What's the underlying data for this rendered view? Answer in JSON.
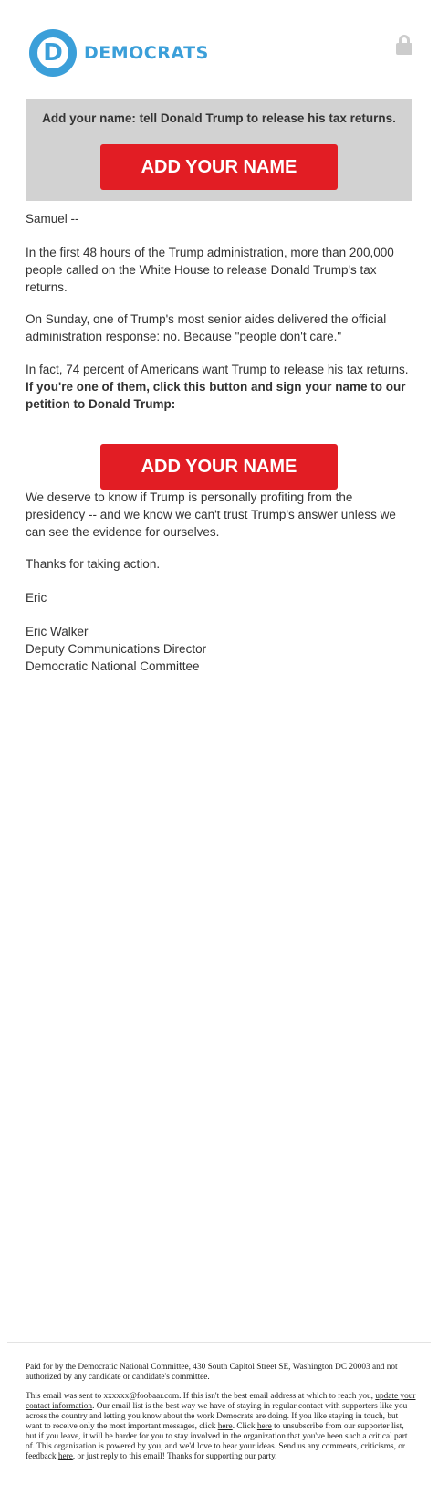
{
  "header": {
    "logo_letter": "D",
    "logo_text": "DEMOCRATS",
    "brand_color": "#3b9fd9",
    "lock_icon": "lock-icon"
  },
  "banner": {
    "text": "Add your name: tell Donald Trump to release his tax returns.",
    "button_label": "ADD YOUR NAME",
    "background": "#d2d2d2",
    "button_color": "#e21d24"
  },
  "email": {
    "greeting": "Samuel --",
    "p1": "In the first 48 hours of the Trump administration, more than 200,000 people called on the White House to release Donald Trump's tax returns.",
    "p2": "On Sunday, one of Trump's most senior aides delivered the official administration response: no. Because \"people don't care.\"",
    "p3_plain": "In fact, 74 percent of Americans want Trump to release his tax returns.",
    "p3_bold": "If you're one of them, click this button and sign your name to our petition to Donald Trump:",
    "button_label": "ADD YOUR NAME",
    "p4": "We deserve to know if Trump is personally profiting from the presidency -- and we know we can't trust Trump's answer unless we can see the evidence for ourselves.",
    "thanks": "Thanks for taking action.",
    "sign_name": "Eric",
    "signature": {
      "name": "Eric Walker",
      "title": "Deputy Communications Director",
      "org": "Democratic National Committee"
    }
  },
  "footer": {
    "paid_for": "Paid for by the Democratic National Committee, 430 South Capitol Street SE, Washington DC 20003 and not authorized by any candidate or candidate's committee.",
    "t1": "This email was sent to xxxxxx@foobaar.com. If this isn't the best email address at which to reach you, ",
    "update_link": "update your contact information",
    "t2": ". Our email list is the best way we have of staying in regular contact with supporters like you across the country and letting you know about the work Democrats are doing. If you like staying in touch, but want to receive only the most important messages, click ",
    "here1": "here",
    "t3": ". Click ",
    "here2": "here",
    "t4": " to unsubscribe from our supporter list, but if you leave, it will be harder for you to stay involved in the organization that you've been such a critical part of. This organization is powered by you, and we'd love to hear your ideas. Send us any comments, criticisms, or feedback ",
    "here3": "here",
    "t5": ", or just reply to this email! Thanks for supporting our party."
  }
}
